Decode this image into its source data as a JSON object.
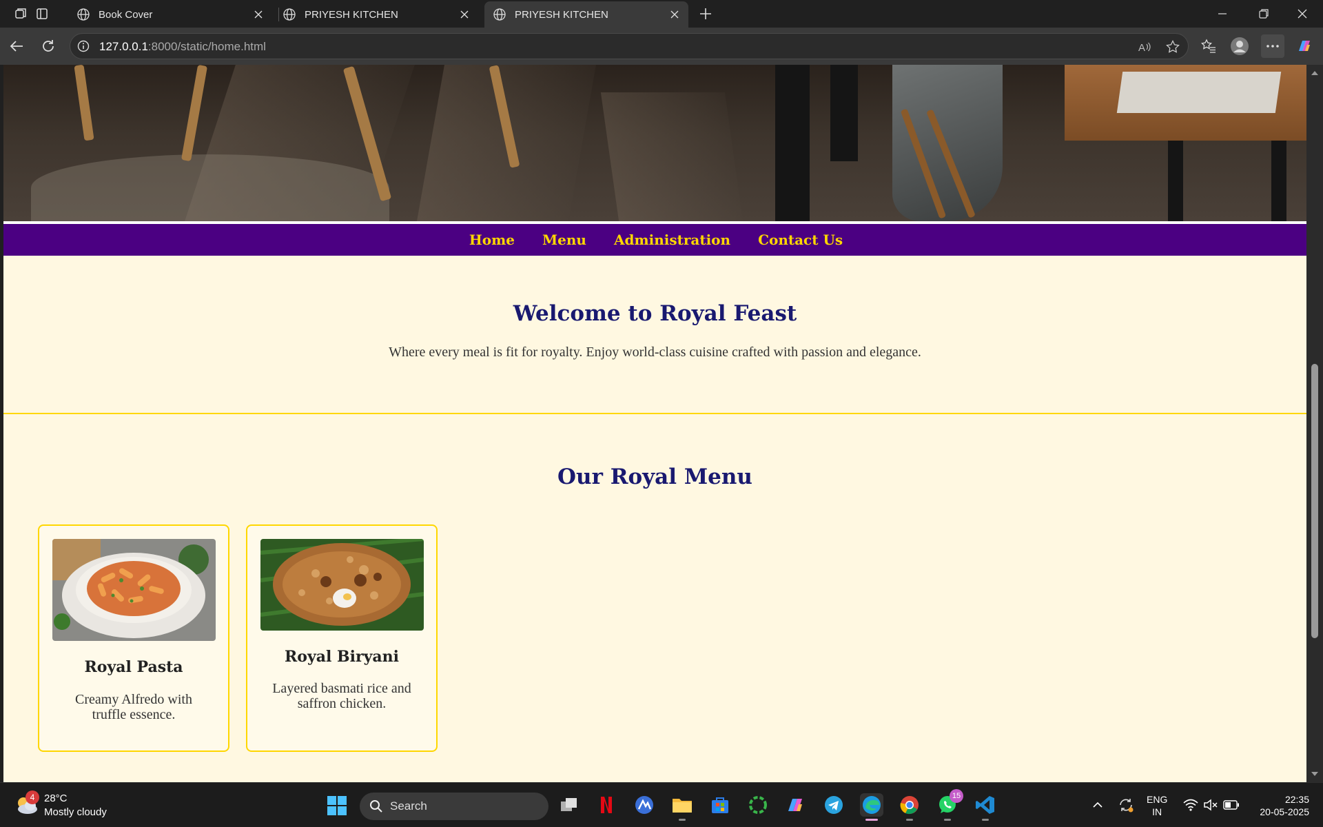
{
  "browser": {
    "tabs": [
      {
        "title": "Book Cover",
        "active": false
      },
      {
        "title": "PRIYESH KITCHEN",
        "active": false
      },
      {
        "title": "PRIYESH KITCHEN",
        "active": true
      }
    ],
    "url_host": "127.0.0.1",
    "url_rest": ":8000/static/home.html"
  },
  "page": {
    "nav": [
      "Home",
      "Menu",
      "Administration",
      "Contact Us"
    ],
    "welcome_title": "Welcome to Royal Feast",
    "welcome_text": "Where every meal is fit for royalty. Enjoy world-class cuisine crafted with passion and elegance.",
    "menu_title": "Our Royal Menu",
    "cards": [
      {
        "name": "Royal Pasta",
        "desc": "Creamy Alfredo with truffle essence."
      },
      {
        "name": "Royal Biryani",
        "desc": "Layered basmati rice and saffron chicken."
      }
    ],
    "colors": {
      "nav_bg": "#4b0082",
      "nav_text": "#ffd700",
      "heading": "#191970",
      "page_bg": "#fff8e1",
      "accent": "#ffd700"
    }
  },
  "taskbar": {
    "weather_badge": "4",
    "weather_temp": "28°C",
    "weather_desc": "Mostly cloudy",
    "search_label": "Search",
    "whatsapp_badge": "15",
    "lang_line1": "ENG",
    "lang_line2": "IN",
    "time": "22:35",
    "date": "20-05-2025"
  }
}
